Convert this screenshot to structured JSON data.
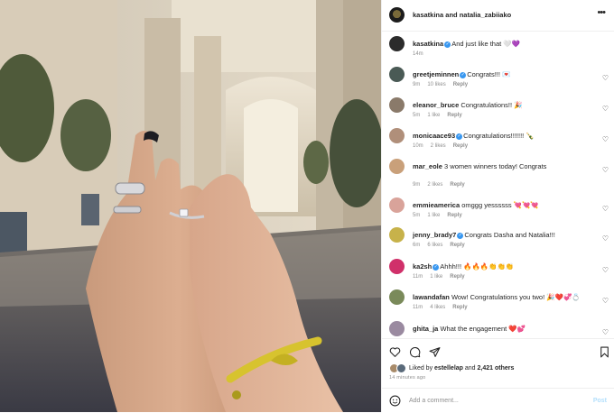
{
  "header": {
    "title": "kasatkina and natalia_zabiiako",
    "more_icon": "more-horizontal-icon"
  },
  "comments": [
    {
      "user": "kasatkina",
      "verified": true,
      "text": "And just like that 🤍💜",
      "time": "14m",
      "likes": "",
      "reply": "",
      "caption": true,
      "avatar_color": "#2b2b2b"
    },
    {
      "user": "greetjeminnen",
      "verified": true,
      "text": "Congrats!!! 💌",
      "time": "9m",
      "likes": "10 likes",
      "reply": "Reply",
      "avatar_color": "#4a5a55"
    },
    {
      "user": "eleanor_bruce",
      "verified": false,
      "text": "Congratulations!! 🎉",
      "time": "5m",
      "likes": "1 like",
      "reply": "Reply",
      "avatar_color": "#8a7a6a"
    },
    {
      "user": "monicaace93",
      "verified": true,
      "text": "Congratulations!!!!!!! 🍾",
      "time": "10m",
      "likes": "2 likes",
      "reply": "Reply",
      "avatar_color": "#b08f7a"
    },
    {
      "user": "mar_eole",
      "verified": false,
      "text": "3 women winners today! Congrats",
      "time": "9m",
      "likes": "2 likes",
      "reply": "Reply",
      "avatar_color": "#c9a07a"
    },
    {
      "user": "emmieamerica",
      "verified": false,
      "text": "omggg yessssss 💘💘💘",
      "time": "5m",
      "likes": "1 like",
      "reply": "Reply",
      "avatar_color": "#d9a39a"
    },
    {
      "user": "jenny_brady7",
      "verified": true,
      "text": "Congrats Dasha and Natalia!!!",
      "time": "6m",
      "likes": "6 likes",
      "reply": "Reply",
      "avatar_color": "#c7b24a"
    },
    {
      "user": "ka2sh",
      "verified": true,
      "text": "Ahhh!!! 🔥🔥🔥👏👏👏",
      "time": "11m",
      "likes": "1 like",
      "reply": "Reply",
      "avatar_color": "#d0306a"
    },
    {
      "user": "lawandafan",
      "verified": false,
      "text": "Wow! Congratulations you two! 🎉❤️💞💍",
      "time": "11m",
      "likes": "4 likes",
      "reply": "Reply",
      "avatar_color": "#7a8a5a"
    },
    {
      "user": "ghita_ja",
      "verified": false,
      "text": "What the engagement ❤️💕",
      "time": "",
      "likes": "",
      "reply": "",
      "avatar_color": "#9a8aa0"
    }
  ],
  "actions": {
    "like": "heart-icon",
    "comment": "comment-icon",
    "share": "share-icon",
    "save": "bookmark-icon"
  },
  "likes": {
    "prefix": "Liked by ",
    "user": "estellelap",
    "mid": " and ",
    "others": "2,421 others"
  },
  "timestamp": "14 minutes ago",
  "add_comment": {
    "placeholder": "Add a comment...",
    "post": "Post",
    "emoji_icon": "emoji-icon"
  },
  "colors": {
    "verified": "#3897f0",
    "muted": "#8e8e8e",
    "post": "#b2dffc",
    "text": "#262626"
  }
}
